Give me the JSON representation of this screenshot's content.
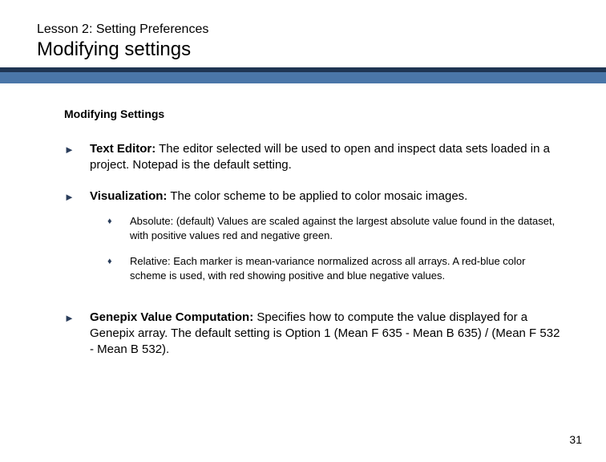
{
  "header": {
    "lesson": "Lesson 2: Setting Preferences",
    "title": "Modifying settings"
  },
  "subhead": "Modifying Settings",
  "items": [
    {
      "label": "Text Editor:",
      "text": " The editor selected will be used to open and inspect data sets loaded in a project. Notepad is the default setting."
    },
    {
      "label": "Visualization:",
      "text": " The color scheme to be applied to color mosaic images.",
      "sub": [
        "Absolute: (default) Values are scaled against the largest absolute value found in the dataset, with positive values red and negative green.",
        "Relative: Each marker is mean-variance normalized across all arrays.   A red-blue color scheme is used, with red showing positive and blue negative values."
      ]
    },
    {
      "label": "Genepix Value Computation:",
      "text": " Specifies how to compute the value displayed for a Genepix array. The default setting is Option 1 (Mean F 635 - Mean B 635) / (Mean F 532 - Mean B 532)."
    }
  ],
  "page_number": "31",
  "glyphs": {
    "arrow": "►",
    "diamond": "♦"
  }
}
